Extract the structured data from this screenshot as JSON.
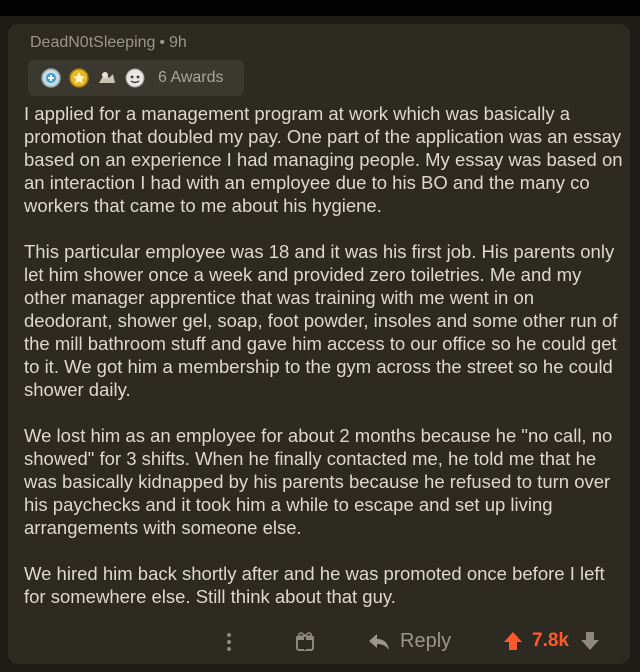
{
  "comment": {
    "author": "DeadN0tSleeping",
    "separator": "•",
    "age": "9h",
    "awards_label": "6 Awards",
    "paragraphs": [
      "I applied for a management program at work which was basically a promotion that doubled my pay. One part of the application was an essay based on an experience I had managing people. My essay was based on an interaction I had with an employee due to his BO and the many co workers that came to me about his hygiene.",
      "This particular employee was 18 and it was his first job. His parents only let him shower once a week and provided zero toiletries. Me and my other manager apprentice that was training with me went in on deodorant, shower gel, soap, foot powder, insoles and some other run of the mill bathroom stuff and gave him access to our office so he could get to it. We got him a membership to the gym across the street so he could shower daily.",
      "We lost him as an employee for about 2 months because he \"no call, no showed\" for 3 shifts. When he finally contacted me, he told me that he was basically kidnapped by his parents because he refused to turn over his paychecks and it took him a while to escape and set up living arrangements with someone else.",
      "We hired him back shortly after and he was promoted once before I left for somewhere else. Still think about that guy."
    ]
  },
  "actions": {
    "reply_label": "Reply",
    "score": "7.8k"
  },
  "colors": {
    "upvote": "#ff5a2b",
    "card": "#2d2a22",
    "text": "#ded9cc"
  },
  "icons": [
    "award-helpful-icon",
    "award-gold-icon",
    "award-wholesome-icon",
    "award-hugz-icon",
    "more-options-icon",
    "gift-icon",
    "reply-arrow-icon",
    "upvote-icon",
    "downvote-icon"
  ]
}
